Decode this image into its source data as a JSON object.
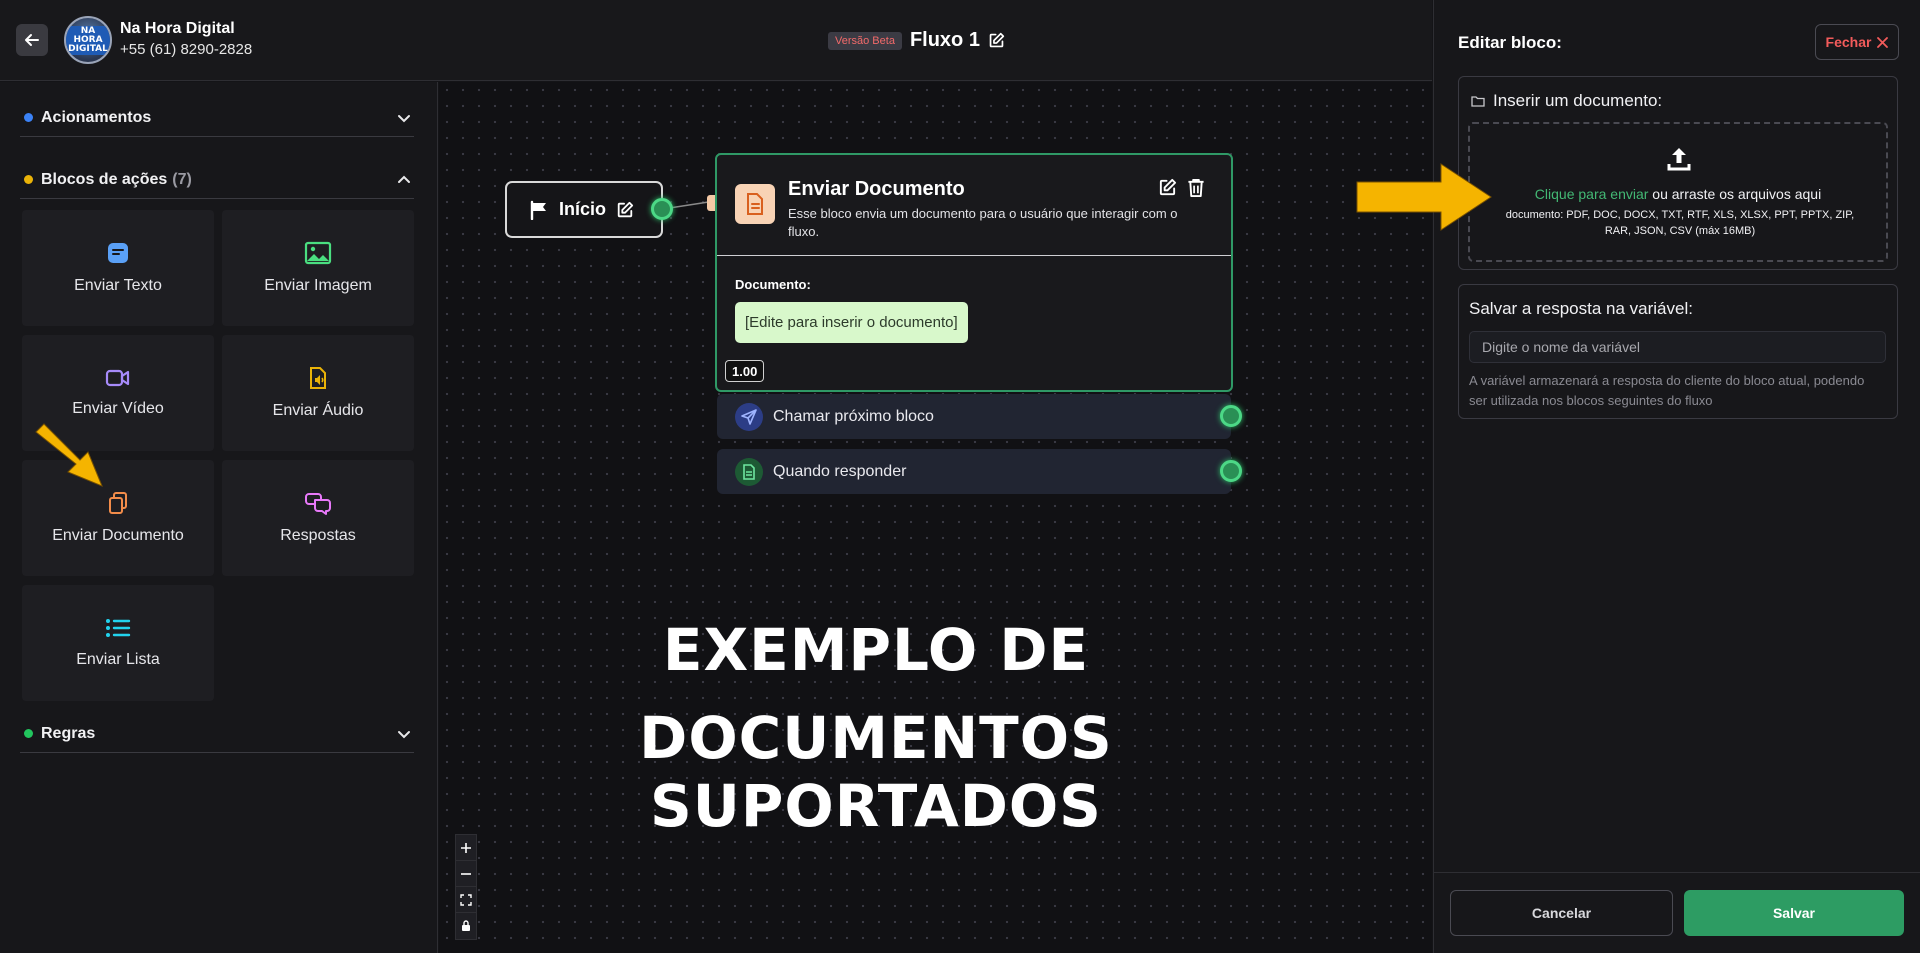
{
  "header": {
    "company_name": "Na Hora Digital",
    "company_phone": "+55 (61) 8290-2828",
    "avatar_text": "NA HORA DIGITAL",
    "beta_badge": "Versão Beta",
    "flow_title": "Fluxo 1"
  },
  "sidebar": {
    "sections": [
      {
        "title": "Acionamentos",
        "dot_color": "#3b82f6",
        "expanded": false
      },
      {
        "title": "Blocos de ações",
        "count": "(7)",
        "dot_color": "#eab308",
        "expanded": true
      },
      {
        "title": "Regras",
        "dot_color": "#22c55e",
        "expanded": false
      }
    ],
    "blocks": [
      {
        "label": "Enviar Texto",
        "icon": "message-text-icon",
        "color": "#5aa0f6"
      },
      {
        "label": "Enviar Imagem",
        "icon": "image-icon",
        "color": "#4ade80"
      },
      {
        "label": "Enviar Vídeo",
        "icon": "video-camera-icon",
        "color": "#a78bfa"
      },
      {
        "label": "Enviar Áudio",
        "icon": "audio-file-icon",
        "color": "#eab308"
      },
      {
        "label": "Enviar Documento",
        "icon": "documents-icon",
        "color": "#f28c4a"
      },
      {
        "label": "Respostas",
        "icon": "chat-bubbles-icon",
        "color": "#e879f9"
      },
      {
        "label": "Enviar Lista",
        "icon": "list-icon",
        "color": "#22d3ee"
      }
    ]
  },
  "canvas": {
    "start_node": {
      "label": "Início"
    },
    "doc_node": {
      "title": "Enviar Documento",
      "description": "Esse bloco envia um documento para o usuário que interagir com o fluxo.",
      "field_label": "Documento:",
      "field_value": "[Edite para inserir o documento]",
      "version": "1.00"
    },
    "outputs": [
      {
        "label": "Chamar próximo bloco",
        "icon": "send-icon"
      },
      {
        "label": "Quando responder",
        "icon": "document-icon"
      }
    ],
    "overlay_text": [
      "EXEMPLO DE",
      "DOCUMENTOS SUPORTADOS"
    ],
    "zoom_controls": [
      "zoom-in-icon",
      "zoom-out-icon",
      "fit-view-icon",
      "lock-icon"
    ]
  },
  "right_panel": {
    "title": "Editar bloco:",
    "close_label": "Fechar",
    "upload": {
      "heading": "Inserir um documento:",
      "link_text": "Clique para enviar",
      "rest_text": " ou arraste os arquivos aqui",
      "formats": "documento: PDF, DOC, DOCX, TXT, RTF, XLS, XLSX, PPT, PPTX, ZIP, RAR, JSON, CSV (máx 16MB)"
    },
    "variable": {
      "heading": "Salvar a resposta na variável:",
      "placeholder": "Digite o nome da variável",
      "help": "A variável armazenará a resposta do cliente do bloco atual, podendo ser utilizada nos blocos seguintes do fluxo"
    },
    "cancel_label": "Cancelar",
    "save_label": "Salvar"
  },
  "colors": {
    "accent_green": "#2d9c63",
    "arrow_yellow": "#f5b400",
    "danger": "#f25b5b"
  }
}
